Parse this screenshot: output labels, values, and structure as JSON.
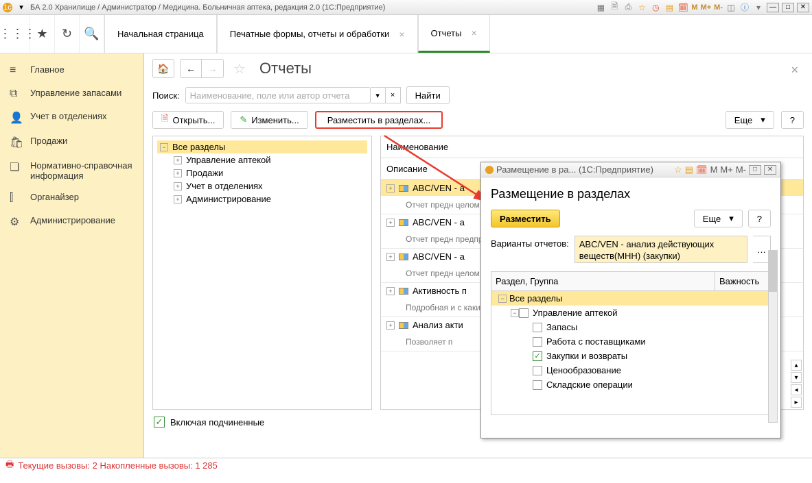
{
  "titlebar": {
    "title": "БА 2.0 Хранилище / Администратор / Медицина. Больничная аптека, редакция 2.0  (1С:Предприятие)",
    "m_labels": [
      "M",
      "M+",
      "M-"
    ]
  },
  "tabs": {
    "start": "Начальная страница",
    "t1": "Печатные формы, отчеты и обработки",
    "t2": "Отчеты"
  },
  "sidebar": {
    "items": [
      {
        "icon": "≡",
        "label": "Главное"
      },
      {
        "icon": "⧉",
        "label": "Управление запасами"
      },
      {
        "icon": "👤",
        "label": "Учет в отделениях"
      },
      {
        "icon": "🛍",
        "label": "Продажи"
      },
      {
        "icon": "❏",
        "label": "Нормативно-справочная информация"
      },
      {
        "icon": "⫿",
        "label": "Органайзер"
      },
      {
        "icon": "⚙",
        "label": "Администрирование"
      }
    ]
  },
  "page": {
    "title": "Отчеты",
    "search_label": "Поиск:",
    "search_placeholder": "Наименование, поле или автор отчета",
    "find_btn": "Найти",
    "open_btn": "Открыть...",
    "edit_btn": "Изменить...",
    "place_btn": "Разместить в разделах...",
    "more_btn": "Еще",
    "help": "?",
    "include_sub": "Включая подчиненные",
    "left_tree": {
      "root": "Все разделы",
      "children": [
        "Управление аптекой",
        "Продажи",
        "Учет в отделениях",
        "Администрирование"
      ]
    },
    "right_head1": "Наименование",
    "right_head2": "Описание",
    "rows": [
      {
        "name": "ABC/VEN - а",
        "desc": "Отчет предн\nцелом по пр"
      },
      {
        "name": "ABC/VEN - а",
        "desc": "Отчет предн\nпредприяти"
      },
      {
        "name": "ABC/VEN - а",
        "desc": "Отчет предн\nцелом по пр"
      },
      {
        "name": "Активность п",
        "desc": "Подробная и\nс какими обт"
      },
      {
        "name": "Анализ акти",
        "desc": "Позволяет п"
      }
    ]
  },
  "dialog": {
    "title": "Размещение в ра...  (1С:Предприятие)",
    "heading": "Размещение в разделах",
    "place_btn": "Разместить",
    "more_btn": "Еще",
    "help": "?",
    "variants_label": "Варианты отчетов:",
    "variants_value": "ABC/VEN - анализ действующих веществ(МНН) (закупки)",
    "col1": "Раздел, Группа",
    "col2": "Важность",
    "tree": {
      "root": "Все разделы",
      "child1": "Управление аптекой",
      "leaves": [
        "Запасы",
        "Работа с поставщиками",
        "Закупки и возвраты",
        "Ценообразование",
        "Складские операции"
      ],
      "checked_index": 2
    }
  },
  "statusbar": {
    "text": "Текущие вызовы: 2  Накопленные вызовы: 1 285"
  }
}
